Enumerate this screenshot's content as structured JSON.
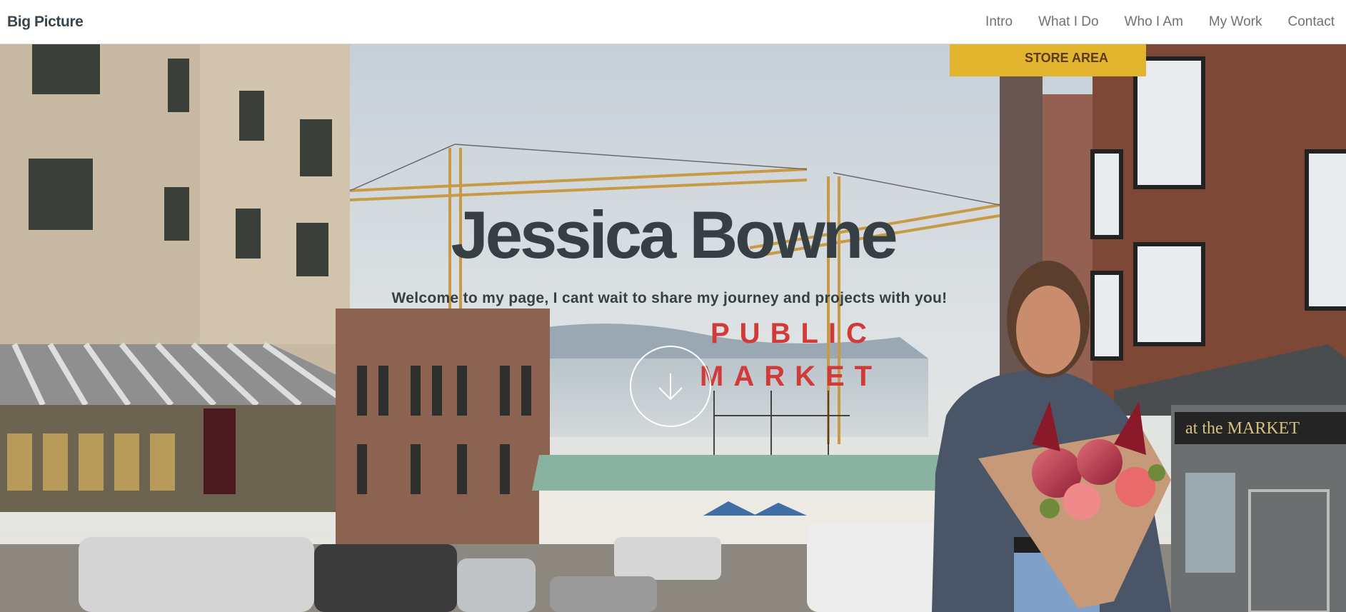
{
  "nav": {
    "brand": "Big Picture",
    "links": [
      "Intro",
      "What I Do",
      "Who I Am",
      "My Work",
      "Contact"
    ]
  },
  "hero": {
    "title": "Jessica Bowne",
    "subtitle": "Welcome to my page, I cant wait to share my journey and projects with you!",
    "scroll_icon": "arrow-down-icon"
  },
  "scene": {
    "market_sign_line1": "PUBLIC",
    "market_sign_line2": "MARKET",
    "storefront_sign": "at the MARKET",
    "loading_sign": "STORE AREA"
  },
  "colors": {
    "nav_bg": "#ffffff",
    "nav_text": "#6b7378",
    "brand_text": "#39454b",
    "hero_text": "#353f44",
    "sign_red": "#d23a3a",
    "sky": "#cfd6dc"
  }
}
